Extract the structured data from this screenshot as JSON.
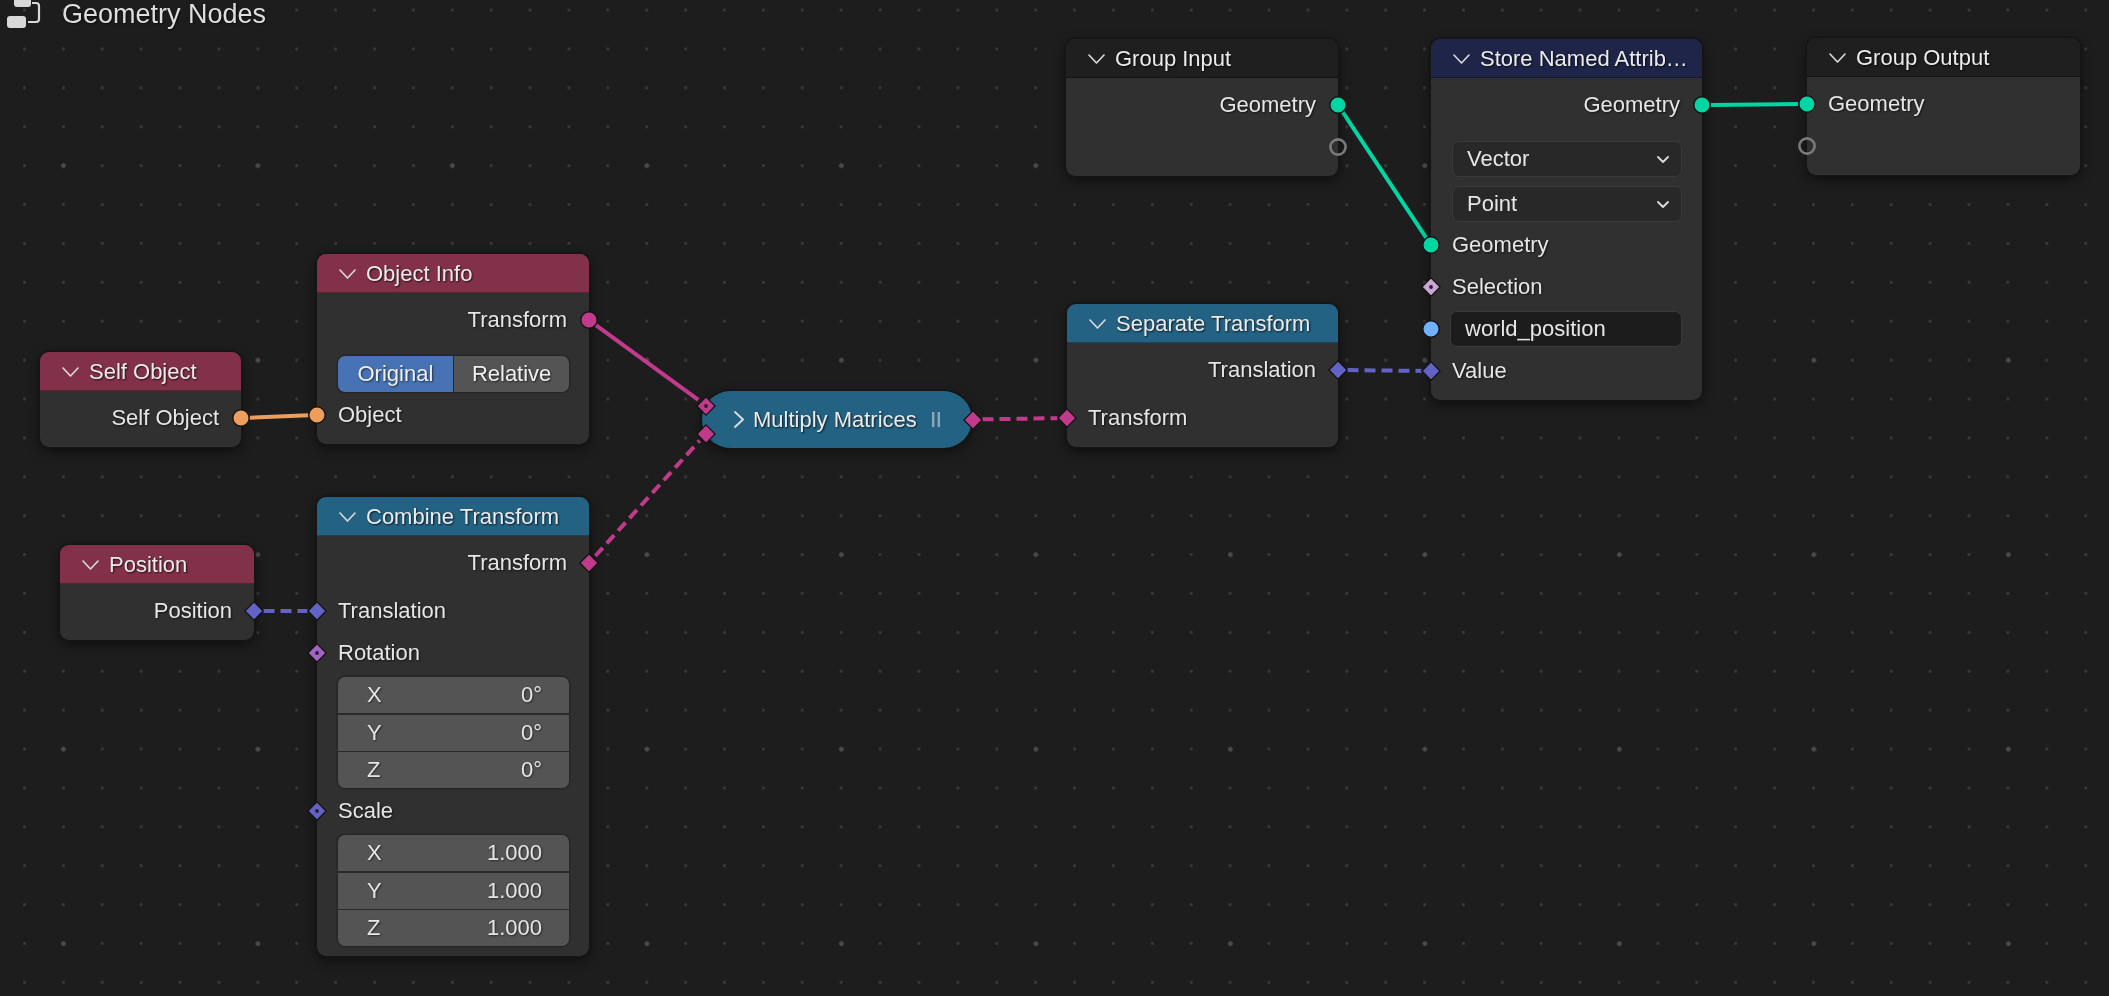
{
  "editor": {
    "title": "Geometry Nodes"
  },
  "nodes": [
    {
      "title": "Group Input",
      "color": "#1f1f1f",
      "expanded": true,
      "rows": [
        {
          "kind": "output",
          "label": "Geometry",
          "socket": {
            "kind": "circle",
            "color": "#00d6a3"
          }
        },
        {
          "kind": "output",
          "socket": {
            "kind": "ring",
            "color": "#7a7a7a"
          }
        }
      ]
    },
    {
      "title": "Store Named Attrib…",
      "color": "#1e2549",
      "expanded": true,
      "rows": [
        {
          "kind": "output",
          "label": "Geometry",
          "socket": {
            "kind": "circle",
            "color": "#00d6a3"
          }
        },
        {
          "kind": "dropdown",
          "value": "Vector"
        },
        {
          "kind": "dropdown",
          "value": "Point"
        },
        {
          "kind": "input",
          "label": "Geometry",
          "socket": {
            "kind": "circle",
            "color": "#00d6a3"
          }
        },
        {
          "kind": "input",
          "label": "Selection",
          "socket": {
            "kind": "diamond-dot",
            "color": "#cca6d6"
          }
        },
        {
          "kind": "field",
          "value": "world_position",
          "socket": {
            "kind": "circle",
            "color": "#70b2ff"
          }
        },
        {
          "kind": "input",
          "label": "Value",
          "socket": {
            "kind": "diamond",
            "color": "#6363c7"
          }
        }
      ]
    },
    {
      "title": "Group Output",
      "color": "#1f1f1f",
      "expanded": true,
      "rows": [
        {
          "kind": "input",
          "label": "Geometry",
          "socket": {
            "kind": "circle",
            "color": "#00d6a3"
          }
        },
        {
          "kind": "input",
          "socket": {
            "kind": "ring",
            "color": "#7a7a7a"
          }
        }
      ]
    },
    {
      "title": "Self Object",
      "color": "#83314a",
      "expanded": true,
      "rows": [
        {
          "kind": "output",
          "label": "Self Object",
          "socket": {
            "kind": "circle",
            "color": "#ed9e5c"
          }
        }
      ]
    },
    {
      "title": "Object Info",
      "color": "#83314a",
      "expanded": true,
      "rows": [
        {
          "kind": "output",
          "label": "Transform",
          "socket": {
            "kind": "circle",
            "color": "#c23a8c"
          }
        },
        {
          "kind": "toggle",
          "options": [
            {
              "label": "Original",
              "selected": true
            },
            {
              "label": "Relative",
              "selected": false
            }
          ]
        },
        {
          "kind": "input",
          "label": "Object",
          "socket": {
            "kind": "circle",
            "color": "#ed9e5c"
          }
        }
      ]
    },
    {
      "title": "Multiply Matrices",
      "color": "#246283",
      "expanded": false,
      "rows": [
        {
          "kind": "input",
          "socket": {
            "kind": "diamond-dot",
            "color": "#c23a8c"
          }
        },
        {
          "kind": "input",
          "socket": {
            "kind": "diamond",
            "color": "#c23a8c"
          }
        },
        {
          "kind": "output",
          "socket": {
            "kind": "diamond",
            "color": "#c23a8c"
          }
        }
      ]
    },
    {
      "title": "Separate Transform",
      "color": "#246283",
      "expanded": true,
      "rows": [
        {
          "kind": "output",
          "label": "Translation",
          "socket": {
            "kind": "diamond",
            "color": "#6363c7"
          }
        },
        {
          "kind": "input",
          "label": "Transform",
          "socket": {
            "kind": "diamond",
            "color": "#c23a8c"
          }
        }
      ]
    },
    {
      "title": "Position",
      "color": "#83314a",
      "expanded": true,
      "rows": [
        {
          "kind": "output",
          "label": "Position",
          "socket": {
            "kind": "diamond",
            "color": "#6363c7"
          }
        }
      ]
    },
    {
      "title": "Combine Transform",
      "color": "#246283",
      "expanded": true,
      "rows": [
        {
          "kind": "output",
          "label": "Transform",
          "socket": {
            "kind": "diamond",
            "color": "#c23a8c"
          }
        },
        {
          "kind": "input",
          "label": "Translation",
          "socket": {
            "kind": "diamond",
            "color": "#6363c7"
          }
        },
        {
          "kind": "input",
          "label": "Rotation",
          "socket": {
            "kind": "diamond-dot",
            "color": "#a663c7"
          },
          "values": [
            {
              "axis": "X",
              "value": "0°"
            },
            {
              "axis": "Y",
              "value": "0°"
            },
            {
              "axis": "Z",
              "value": "0°"
            }
          ]
        },
        {
          "kind": "input",
          "label": "Scale",
          "socket": {
            "kind": "diamond-dot",
            "color": "#6363c7"
          },
          "values": [
            {
              "axis": "X",
              "value": "1.000"
            },
            {
              "axis": "Y",
              "value": "1.000"
            },
            {
              "axis": "Z",
              "value": "1.000"
            }
          ]
        }
      ]
    }
  ],
  "links": [
    {
      "dashed": false
    },
    {
      "dashed": false
    },
    {
      "dashed": false
    },
    {
      "dashed": false
    },
    {
      "dashed": true
    },
    {
      "dashed": true
    },
    {
      "dashed": true
    },
    {
      "dashed": true
    }
  ]
}
